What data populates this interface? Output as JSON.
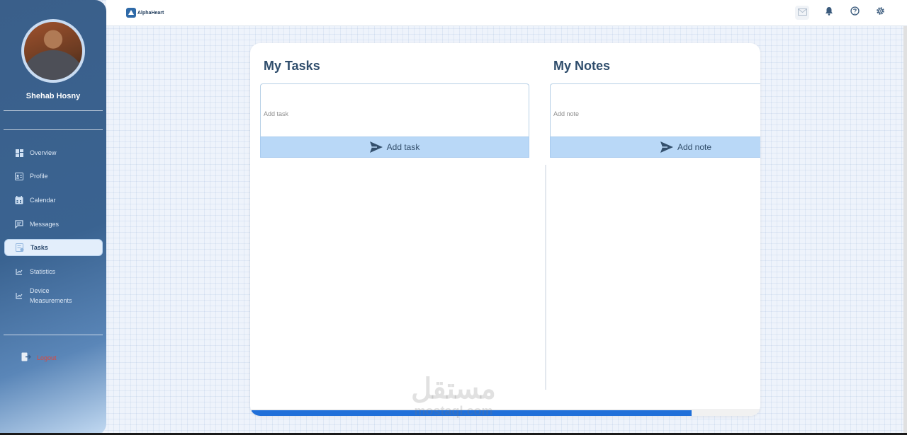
{
  "user": {
    "name": "Shehab Hosny"
  },
  "sidebar": {
    "items": [
      {
        "label": "Overview",
        "icon": "grid-icon"
      },
      {
        "label": "Profile",
        "icon": "id-card-icon"
      },
      {
        "label": "Calendar",
        "icon": "calendar-icon"
      },
      {
        "label": "Messages",
        "icon": "chat-icon"
      },
      {
        "label": "Tasks",
        "icon": "tasks-icon",
        "active": true
      },
      {
        "label": "Statistics",
        "icon": "chart-icon"
      },
      {
        "label": "Device Measurements",
        "icon": "chart-icon"
      }
    ],
    "logout_label": "Logout"
  },
  "topbar": {
    "brand": "AlphaHeart",
    "icons": [
      "mail-icon",
      "bell-icon",
      "help-icon",
      "settings-icon"
    ]
  },
  "tasks": {
    "title": "My Tasks",
    "placeholder": "Add task",
    "button_label": "Add task"
  },
  "notes": {
    "title": "My Notes",
    "placeholder": "Add note",
    "button_label": "Add note"
  },
  "watermark": {
    "arabic": "مستقل",
    "latin": "mostaql.com"
  },
  "colors": {
    "sidebar": "#3a6391",
    "accent_button": "#b9d8f7",
    "scrollbar": "#1f6fd9",
    "logout": "#e0463a",
    "title": "#2f4d6c"
  }
}
